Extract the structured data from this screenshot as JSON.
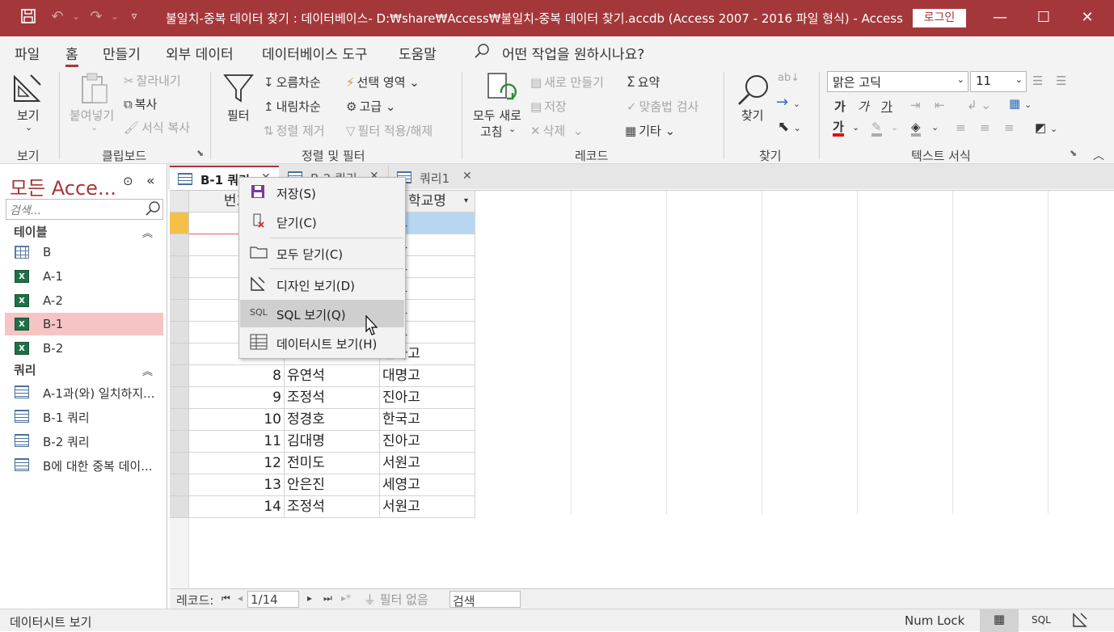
{
  "window": {
    "title": "불일치-중복 데이터 찾기 : 데이터베이스- D:₩share₩Access₩불일치-중복 데이터 찾기.accdb (Access 2007 - 2016 파일 형식)  -  Access",
    "login": "로그인"
  },
  "menu": [
    "파일",
    "홈",
    "만들기",
    "외부 데이터",
    "데이터베이스 도구",
    "도움말"
  ],
  "tell_me": "어떤 작업을 원하시나요?",
  "ribbon": {
    "view": {
      "label": "보기",
      "group": "보기"
    },
    "clipboard": {
      "paste": "붙여넣기",
      "cut": "잘라내기",
      "copy": "복사",
      "format_painter": "서식 복사",
      "group": "클립보드"
    },
    "sort_filter": {
      "filter": "필터",
      "ascending": "오름차순",
      "descending": "내림차순",
      "remove_sort": "정렬 제거",
      "selection": "선택 영역",
      "advanced": "고급",
      "toggle_filter": "필터 적용/해제",
      "group": "정렬 및 필터"
    },
    "records": {
      "refresh_all": "모두 새로\n고침",
      "refresh_line1": "모두 새로",
      "refresh_line2": "고침",
      "new": "새로 만들기",
      "save": "저장",
      "delete": "삭제",
      "totals": "요약",
      "spelling": "맞춤법 검사",
      "more": "기타",
      "group": "레코드"
    },
    "find": {
      "find": "찾기",
      "group": "찾기"
    },
    "text_format": {
      "font": "맑은 고딕",
      "size": "11",
      "bold": "가",
      "italic": "가",
      "underline": "가",
      "group": "텍스트 서식"
    }
  },
  "nav": {
    "title": "모든 Acce...",
    "search_placeholder": "검색...",
    "sections": {
      "tables": "테이블",
      "queries": "쿼리"
    },
    "tables": [
      "B",
      "A-1",
      "A-2",
      "B-1",
      "B-2"
    ],
    "queries": [
      "A-1과(와) 일치하지...",
      "B-1 쿼리",
      "B-2 쿼리",
      "B에 대한 중복 데이..."
    ]
  },
  "tabs": [
    "B-1 쿼리",
    "B-2 쿼리",
    "쿼리1"
  ],
  "grid": {
    "columns": [
      "번호",
      "이름",
      "학교명"
    ],
    "rows": [
      [
        "",
        "",
        "명고"
      ],
      [
        "",
        "",
        "원고"
      ],
      [
        "",
        "",
        "영고"
      ],
      [
        "",
        "",
        "원고"
      ],
      [
        "",
        "",
        "영고"
      ],
      [
        "",
        "",
        "국고"
      ],
      [
        "",
        "",
        "한아고"
      ],
      [
        "8",
        "유연석",
        "대명고"
      ],
      [
        "9",
        "조정석",
        "진아고"
      ],
      [
        "10",
        "정경호",
        "한국고"
      ],
      [
        "11",
        "김대명",
        "진아고"
      ],
      [
        "12",
        "전미도",
        "서원고"
      ],
      [
        "13",
        "안은진",
        "세영고"
      ],
      [
        "14",
        "조정석",
        "서원고"
      ]
    ]
  },
  "record_nav": {
    "label": "레코드:",
    "position": "1/14",
    "filter": "필터 없음",
    "search": "검색"
  },
  "status": {
    "left": "데이터시트 보기",
    "numlock": "Num Lock",
    "sql": "SQL"
  },
  "context_menu": [
    {
      "label": "저장(S)"
    },
    {
      "label": "닫기(C)"
    },
    {
      "label": "모두 닫기(C)"
    },
    {
      "label": "디자인 보기(D)"
    },
    {
      "label": "SQL 보기(Q)"
    },
    {
      "label": "데이터시트 보기(H)"
    }
  ]
}
